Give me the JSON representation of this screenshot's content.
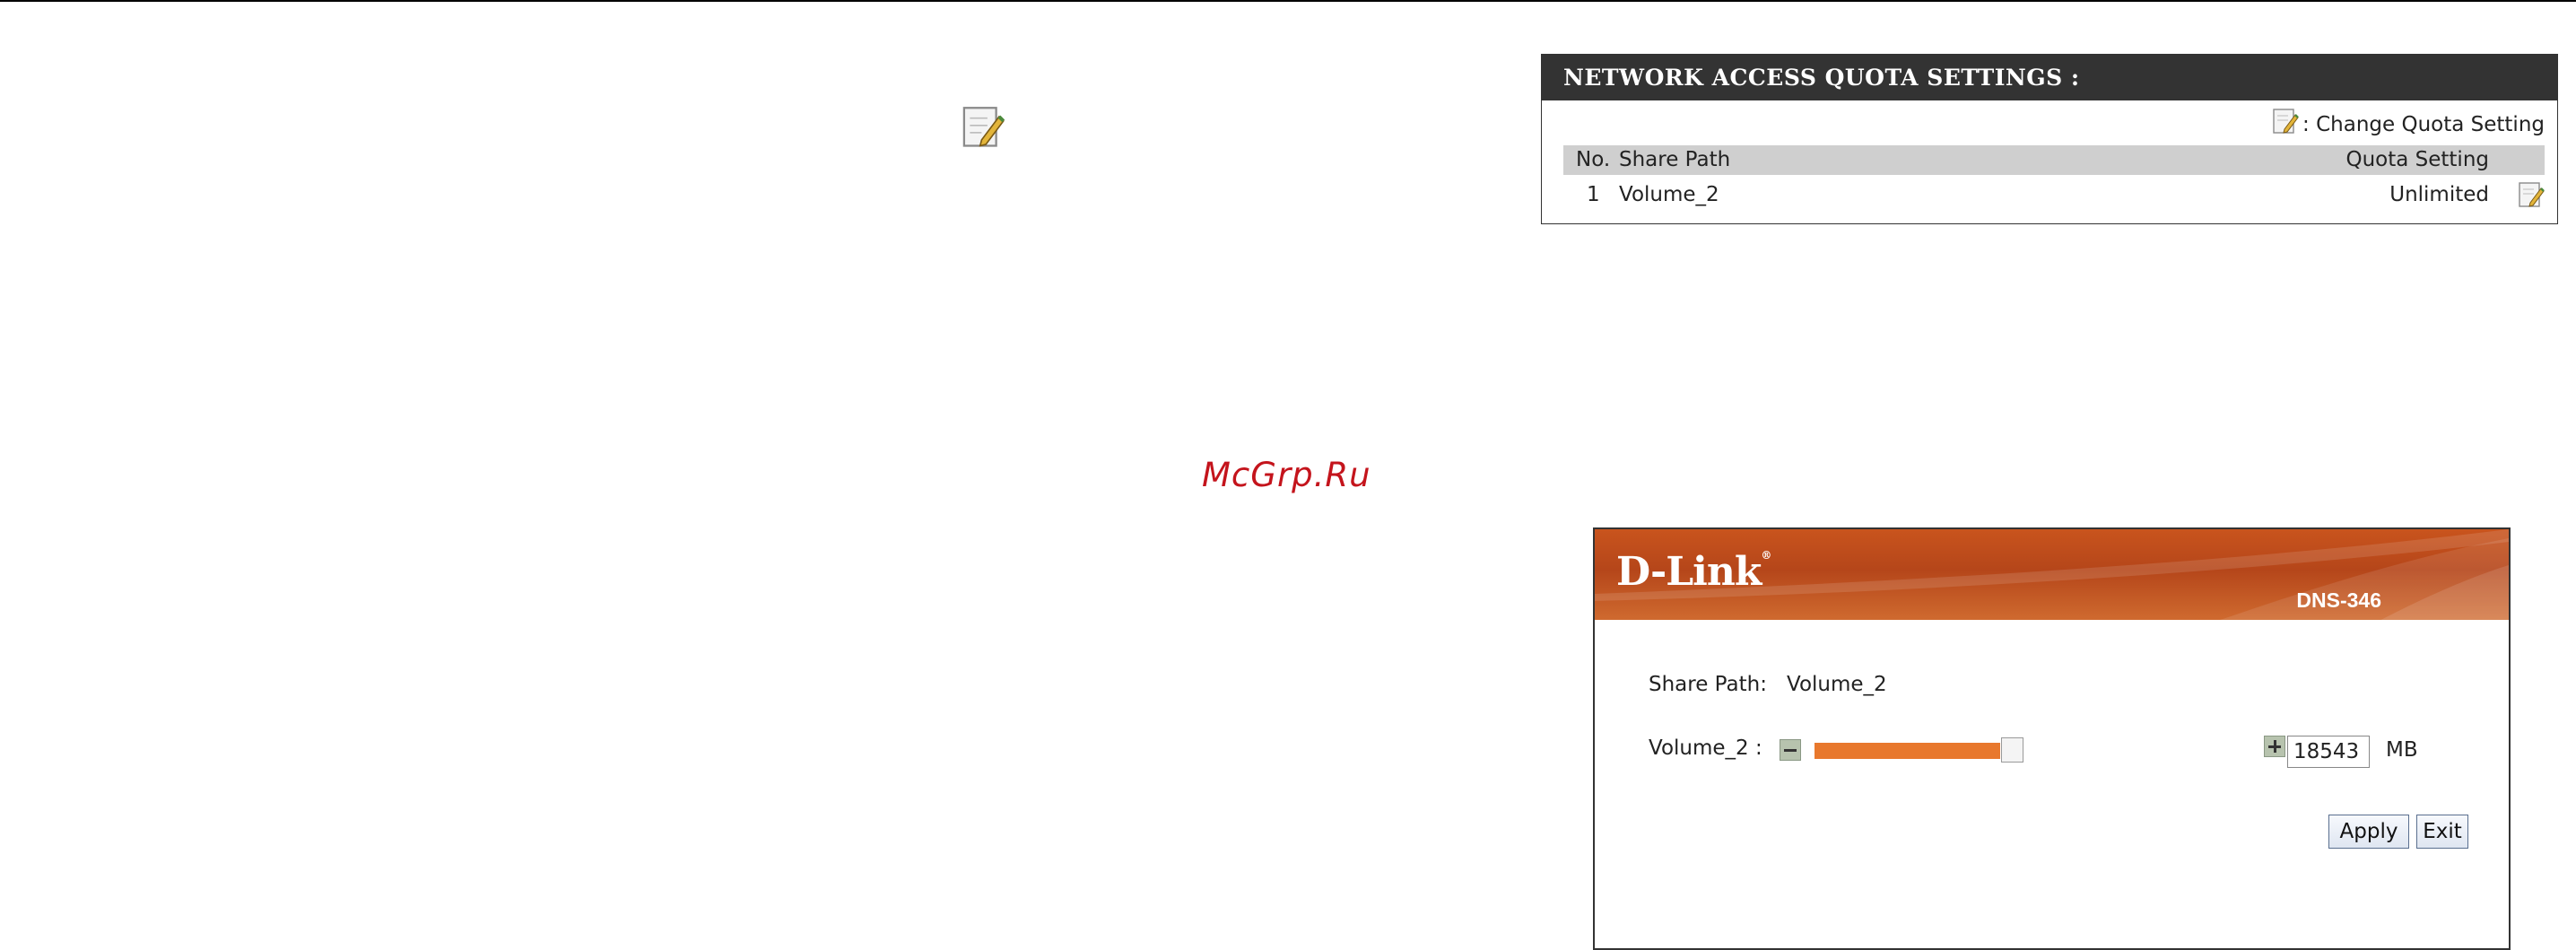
{
  "watermark": "McGrp.Ru",
  "icons": {
    "edit": "edit-note-icon"
  },
  "quota_settings": {
    "title": "NETWORK ACCESS QUOTA SETTINGS :",
    "legend": ": Change Quota Setting",
    "columns": {
      "no": "No.",
      "share_path": "Share Path",
      "quota_setting": "Quota Setting"
    },
    "rows": [
      {
        "no": "1",
        "share_path": "Volume_2",
        "quota_setting": "Unlimited"
      }
    ]
  },
  "dialog": {
    "brand": "D-Link",
    "model": "DNS-346",
    "share_path_label": "Share Path:",
    "share_path_value": "Volume_2",
    "volume_label": "Volume_2 :",
    "quota_value": "18543",
    "quota_fraction": 0.9,
    "unit": "MB",
    "apply_label": "Apply",
    "exit_label": "Exit"
  },
  "colors": {
    "header_bg": "#333333",
    "column_header_bg": "#cfcfcf",
    "banner_orange": "#c9541d",
    "slider_fill": "#e8782d"
  }
}
